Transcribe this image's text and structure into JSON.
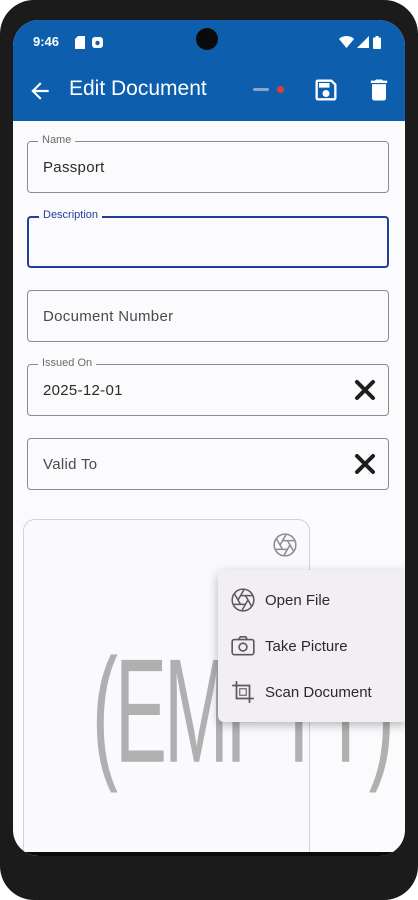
{
  "status_bar": {
    "time": "9:46",
    "icons": [
      "sd-card-icon",
      "media-icon",
      "wifi-icon",
      "signal-icon",
      "battery-icon"
    ]
  },
  "app_bar": {
    "title": "Edit Document",
    "background": "#0d5fae",
    "actions": [
      "sync-indicator",
      "save-icon",
      "delete-icon"
    ]
  },
  "form": {
    "name": {
      "label": "Name",
      "value": "Passport"
    },
    "description": {
      "label": "Description",
      "value": ""
    },
    "document_number": {
      "placeholder": "Document Number"
    },
    "issued_on": {
      "label": "Issued On",
      "value": "2025-12-01"
    },
    "valid_to": {
      "placeholder": "Valid To"
    }
  },
  "attachment": {
    "empty_text": "(EMPTY)"
  },
  "menu": {
    "items": [
      {
        "label": "Open File",
        "icon": "aperture-icon"
      },
      {
        "label": "Take Picture",
        "icon": "camera-icon"
      },
      {
        "label": "Scan Document",
        "icon": "crop-icon"
      }
    ]
  },
  "colors": {
    "accent": "#1f3f99",
    "menu_bg": "#f2eef4"
  }
}
